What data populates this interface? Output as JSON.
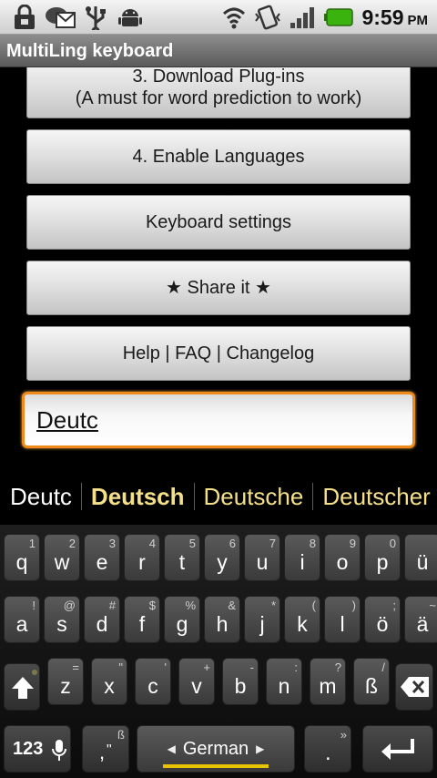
{
  "status": {
    "time": "9:59",
    "ampm": "PM",
    "icons": [
      "lock-icon",
      "mail-icon",
      "usb-icon",
      "android-icon",
      "wifi-icon",
      "vibrate-icon",
      "signal-icon",
      "battery-icon"
    ]
  },
  "app": {
    "title": "MultiLing keyboard"
  },
  "menu": {
    "download_line1": "3. Download Plug-ins",
    "download_line2": "(A must for word prediction to work)",
    "enable_languages": "4. Enable Languages",
    "keyboard_settings": "Keyboard settings",
    "share": "★ Share it ★",
    "help": "Help | FAQ | Changelog"
  },
  "input": {
    "value": "Deutc"
  },
  "suggestions": [
    "Deutc",
    "Deutsch",
    "Deutsche",
    "Deutscher"
  ],
  "colors": {
    "accent_orange": "#f08a1c",
    "suggestion_yellow": "#f5e08a",
    "spacebar_bar": "#e8c400"
  },
  "keyboard": {
    "row1": [
      {
        "k": "q",
        "h": "1"
      },
      {
        "k": "w",
        "h": "2"
      },
      {
        "k": "e",
        "h": "3"
      },
      {
        "k": "r",
        "h": "4"
      },
      {
        "k": "t",
        "h": "5"
      },
      {
        "k": "y",
        "h": "6"
      },
      {
        "k": "u",
        "h": "7"
      },
      {
        "k": "i",
        "h": "8"
      },
      {
        "k": "o",
        "h": "9"
      },
      {
        "k": "p",
        "h": "0"
      },
      {
        "k": "ü",
        "h": ""
      }
    ],
    "row2": [
      {
        "k": "a",
        "h": "!"
      },
      {
        "k": "s",
        "h": "@"
      },
      {
        "k": "d",
        "h": "#"
      },
      {
        "k": "f",
        "h": "$"
      },
      {
        "k": "g",
        "h": "%"
      },
      {
        "k": "h",
        "h": "&"
      },
      {
        "k": "j",
        "h": "*"
      },
      {
        "k": "k",
        "h": "("
      },
      {
        "k": "l",
        "h": ")"
      },
      {
        "k": "ö",
        "h": ";"
      },
      {
        "k": "ä",
        "h": "~"
      }
    ],
    "row3": [
      {
        "k": "z",
        "h": "="
      },
      {
        "k": "x",
        "h": "\""
      },
      {
        "k": "c",
        "h": "'"
      },
      {
        "k": "v",
        "h": "+"
      },
      {
        "k": "b",
        "h": "-"
      },
      {
        "k": "n",
        "h": ":"
      },
      {
        "k": "m",
        "h": "?"
      },
      {
        "k": "ß",
        "h": "/"
      }
    ],
    "symbols_label": "123",
    "comma_main": ",",
    "comma_hint": "ß",
    "comma_sub": "\"",
    "language": "German",
    "period_main": ".",
    "period_hint": "»"
  }
}
